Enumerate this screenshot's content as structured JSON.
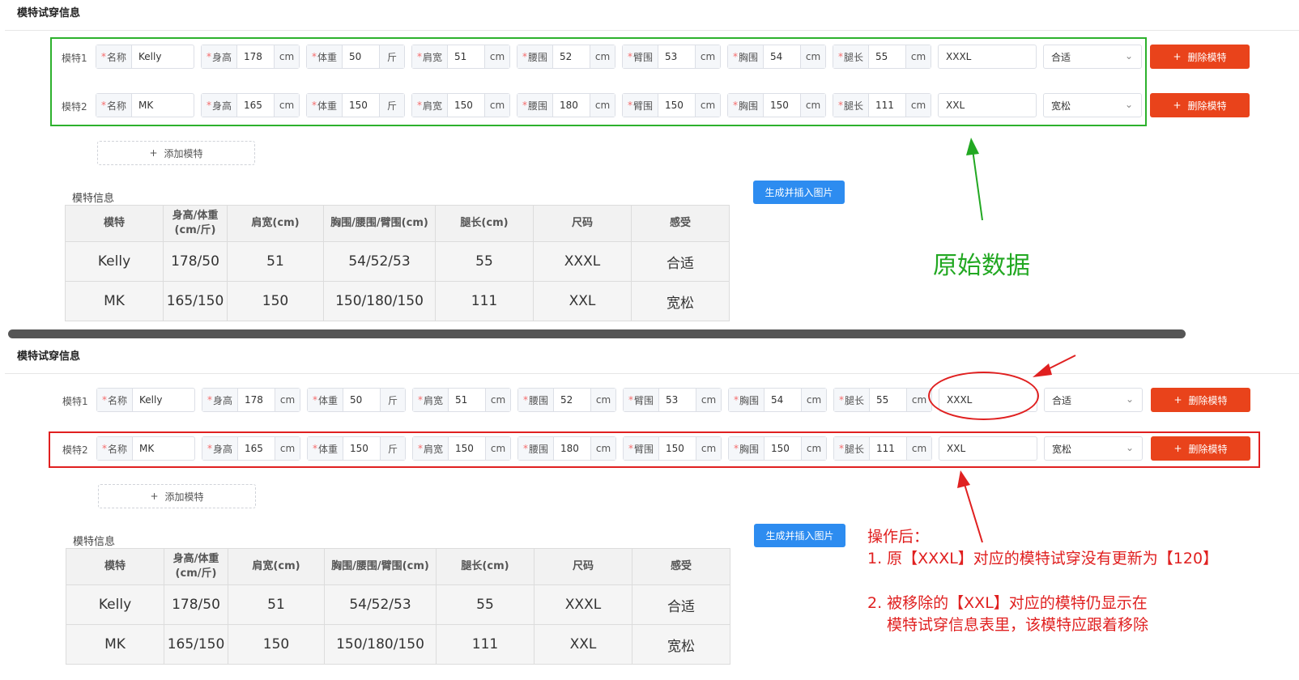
{
  "section_title": "模特试穿信息",
  "labels": {
    "name": "名称",
    "height": "身高",
    "weight": "体重",
    "shoulder": "肩宽",
    "waist": "腰围",
    "arm": "臂围",
    "chest": "胸围",
    "leg": "腿长",
    "required_mark": "*",
    "unit_cm": "cm",
    "unit_jin": "斤"
  },
  "models": [
    {
      "label": "模特1",
      "name": "Kelly",
      "height": "178",
      "weight": "50",
      "shoulder": "51",
      "waist": "52",
      "arm": "53",
      "chest": "54",
      "leg": "55",
      "size": "XXXL",
      "feel": "合适"
    },
    {
      "label": "模特2",
      "name": "MK",
      "height": "165",
      "weight": "150",
      "shoulder": "150",
      "waist": "180",
      "arm": "150",
      "chest": "150",
      "leg": "111",
      "size": "XXL",
      "feel": "宽松"
    }
  ],
  "buttons": {
    "delete_model": "删除模特",
    "add_model": "添加模特",
    "generate_insert": "生成并插入图片",
    "plus": "+"
  },
  "table": {
    "caption": "模特信息",
    "headers": [
      "模特",
      "身高/体重\n(cm/斤)",
      "肩宽(cm)",
      "胸围/腰围/臂围(cm)",
      "腿长(cm)",
      "尺码",
      "感受"
    ],
    "rows": [
      [
        "Kelly",
        "178/50",
        "51",
        "54/52/53",
        "55",
        "XXXL",
        "合适"
      ],
      [
        "MK",
        "165/150",
        "150",
        "150/180/150",
        "111",
        "XXL",
        "宽松"
      ]
    ]
  },
  "annotations": {
    "original_data": "原始数据",
    "after_title": "操作后：",
    "note1": "1. 原【XXXL】对应的模特试穿没有更新为【120】",
    "note2_line1": "2. 被移除的【XXL】对应的模特仍显示在",
    "note2_line2": "模特试穿信息表里，该模特应跟着移除"
  },
  "colors": {
    "annotation_green": "#22a822",
    "annotation_red": "#e02020",
    "delete_button": "#e9431b",
    "generate_button": "#2d8cf0"
  }
}
